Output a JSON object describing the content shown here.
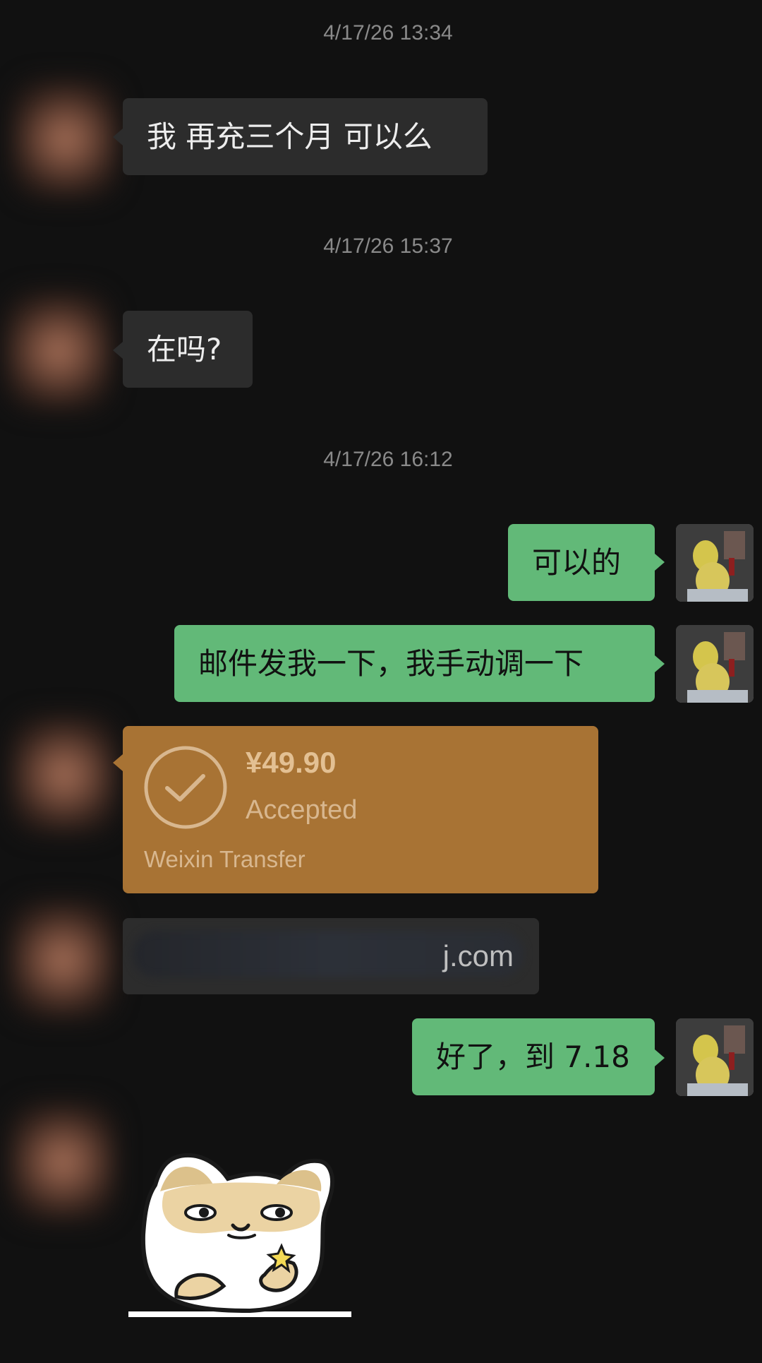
{
  "chat": {
    "timestamps": [
      "4/17/26 13:34",
      "4/17/26 15:37",
      "4/17/26 16:12"
    ],
    "messages": [
      {
        "text": "我 再充三个月 可以么"
      },
      {
        "text": "在吗?"
      },
      {
        "text": "可以的"
      },
      {
        "text": "邮件发我一下，我手动调一下"
      },
      {
        "text": "¥49.90"
      },
      {
        "text": "Accepted"
      },
      {
        "text": "Weixin Transfer"
      },
      {
        "text": "j.com"
      },
      {
        "text": "好了，到 7.18"
      }
    ]
  },
  "colors": {
    "background": "#111111",
    "incoming_bubble": "#2c2c2c",
    "outgoing_bubble": "#62b978",
    "transfer_bubble": "#a87334",
    "timestamp": "#8a8a8a"
  }
}
